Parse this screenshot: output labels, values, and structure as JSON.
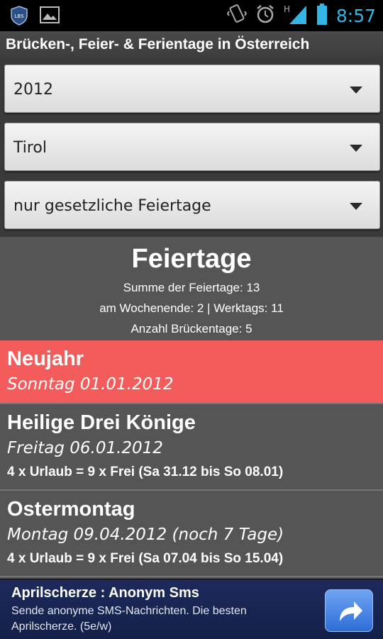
{
  "statusbar": {
    "time": "8:57",
    "network_label": "H",
    "icons": [
      "lbs-app-icon",
      "gallery-icon",
      "vibrate-icon",
      "alarm-icon",
      "signal-icon",
      "battery-icon"
    ]
  },
  "app": {
    "title": "Brücken-, Feier- & Ferientage in Österreich"
  },
  "filters": {
    "year": "2012",
    "region": "Tirol",
    "type": "nur gesetzliche Feiertage"
  },
  "summary": {
    "title": "Feiertage",
    "total": "Summe der Feiertage: 13",
    "weekend_weekday": "am Wochenende: 2 | Werktags: 11",
    "bridge_days": "Anzahl Brückentage: 5"
  },
  "holidays": [
    {
      "name": "Neujahr",
      "date": "Sonntag 01.01.2012",
      "bridge": ""
    },
    {
      "name": "Heilige Drei Könige",
      "date": "Freitag 06.01.2012",
      "bridge": "4 x Urlaub = 9 x Frei (Sa 31.12 bis So 08.01)"
    },
    {
      "name": "Ostermontag",
      "date": "Montag 09.04.2012 (noch 7 Tage)",
      "bridge": "4 x Urlaub = 9 x Frei (Sa 07.04 bis So 15.04)"
    }
  ],
  "ad": {
    "title": "Aprilscherze : Anonym Sms",
    "text": "Sende anonyme SMS-Nachrichten. Die besten Aprilscherze. (5e/w)"
  },
  "colors": {
    "accent": "#33b5e5",
    "highlight": "#f35c5a",
    "list_bg": "#555555",
    "ad_bg": "#1d2a5b"
  }
}
